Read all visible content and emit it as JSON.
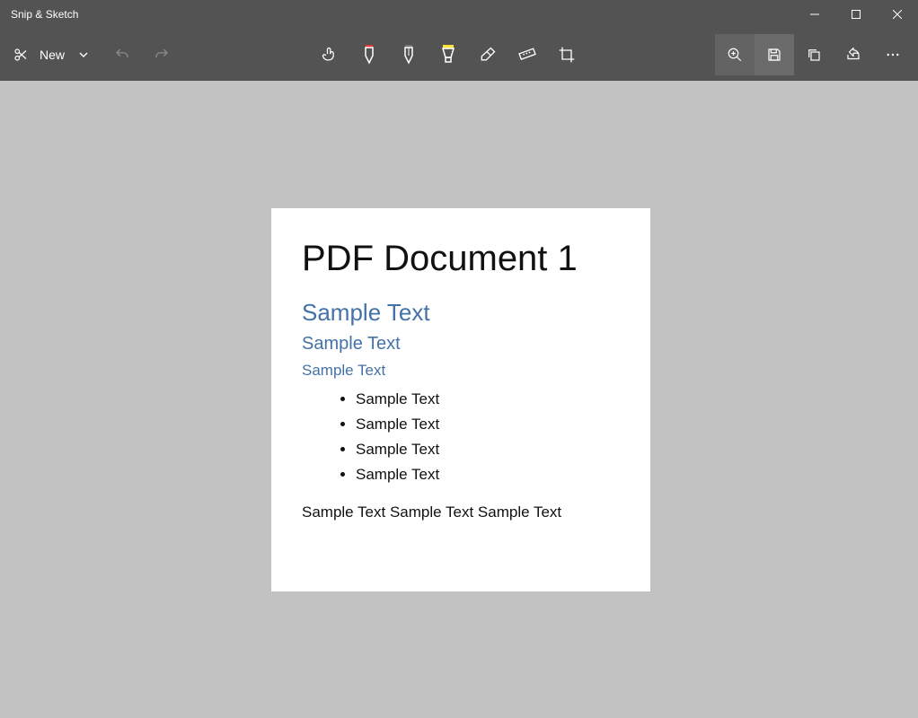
{
  "window": {
    "title": "Snip & Sketch"
  },
  "toolbar": {
    "new_label": "New"
  },
  "document": {
    "title": "PDF Document 1",
    "heading1": "Sample Text",
    "heading2": "Sample Text",
    "heading3": "Sample Text",
    "bullets": [
      "Sample Text",
      "Sample Text",
      "Sample Text",
      "Sample Text"
    ],
    "paragraph": "Sample Text Sample Text Sample Text"
  }
}
